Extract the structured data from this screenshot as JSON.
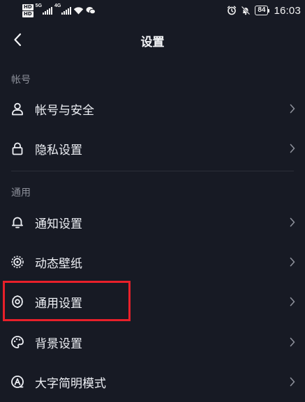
{
  "status_bar": {
    "hd_top": "HD",
    "hd_bottom": "HD",
    "net_1": "5G",
    "net_2": "4G",
    "battery": "84",
    "time": "16:03"
  },
  "nav": {
    "title": "设置"
  },
  "sections": {
    "account": {
      "label": "帐号",
      "items": [
        {
          "label": "帐号与安全",
          "icon": "person-icon"
        },
        {
          "label": "隐私设置",
          "icon": "lock-icon"
        }
      ]
    },
    "general": {
      "label": "通用",
      "items": [
        {
          "label": "通知设置",
          "icon": "bell-icon"
        },
        {
          "label": "动态壁纸",
          "icon": "live-wallpaper-icon"
        },
        {
          "label": "通用设置",
          "icon": "gear-icon"
        },
        {
          "label": "背景设置",
          "icon": "palette-icon"
        },
        {
          "label": "大字简明模式",
          "icon": "large-font-icon"
        }
      ]
    }
  },
  "colors": {
    "background": "#171a24",
    "text": "#eef0f5",
    "muted": "#8d909a",
    "highlight": "#e8202a"
  }
}
